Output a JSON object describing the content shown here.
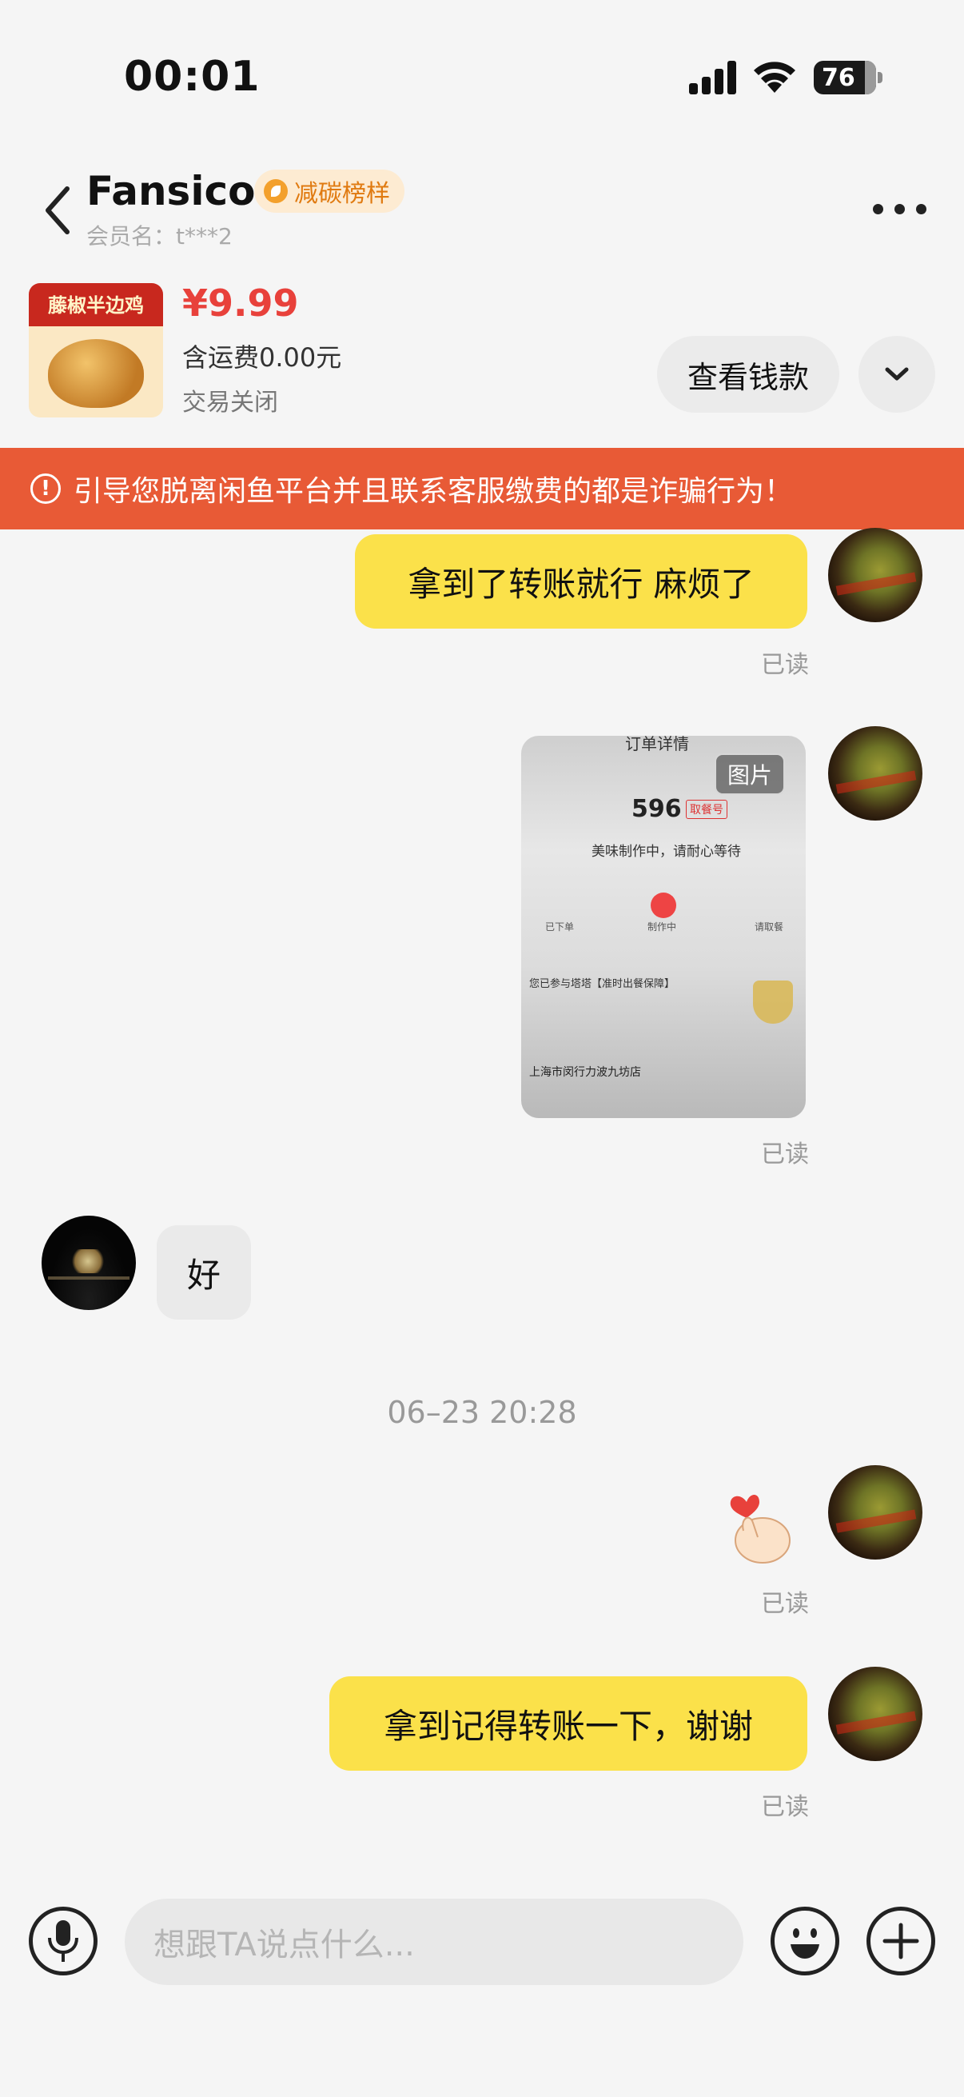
{
  "status_bar": {
    "time": "00:01",
    "battery": "76"
  },
  "header": {
    "title": "Fansico",
    "badge": "减碳榜样",
    "member": "会员名：t***2"
  },
  "product": {
    "thumb_title": "藤椒半边鸡",
    "price": "¥9.99",
    "shipping": "含运费0.00元",
    "status": "交易关闭",
    "view_button": "查看钱款"
  },
  "warning": {
    "icon": "!",
    "text": "引导您脱离闲鱼平台并且联系客服缴费的都是诈骗行为！"
  },
  "messages": {
    "m1": "拿到了转账就行 麻烦了",
    "read": "已读",
    "image_tag": "图片",
    "image_title": "订单详情",
    "image_number": "596",
    "image_number_tag": "取餐号",
    "image_status": "美味制作中，请耐心等待",
    "image_step1": "已下单",
    "image_step2": "制作中",
    "image_step3": "请取餐",
    "image_para": "您已参与塔塔【准时出餐保障】",
    "image_store": "上海市闵行力波九坊店",
    "m_other": "好",
    "timestamp": "06–23 20:28",
    "m2": "拿到记得转账一下，谢谢"
  },
  "input": {
    "placeholder": "想跟TA说点什么..."
  }
}
